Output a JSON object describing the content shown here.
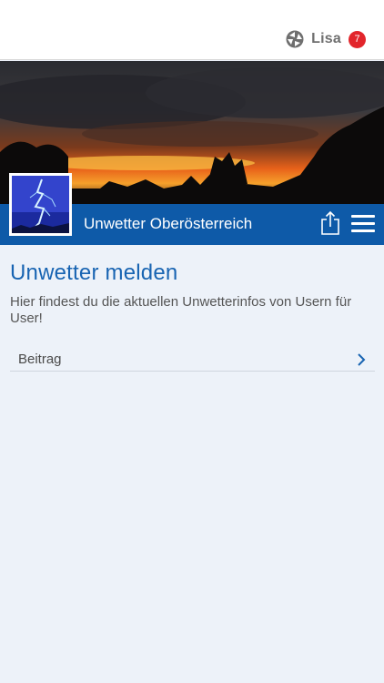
{
  "header": {
    "user_name": "Lisa",
    "notification_count": "7",
    "logo_icon": "app-logo-icon"
  },
  "group": {
    "title": "Unwetter Oberösterreich",
    "share_icon": "share-icon",
    "menu_icon": "hamburger-menu-icon",
    "accent_color": "#0e5aa8"
  },
  "page": {
    "title": "Unwetter melden",
    "description": "Hier findest du die aktuellen Unwetterinfos von Usern für User!"
  },
  "list": {
    "items": [
      {
        "label": "Beitrag",
        "icon": "chevron-right-icon"
      }
    ]
  },
  "colors": {
    "background": "#edf2f9",
    "title": "#1864b2",
    "badge": "#e2252b"
  }
}
